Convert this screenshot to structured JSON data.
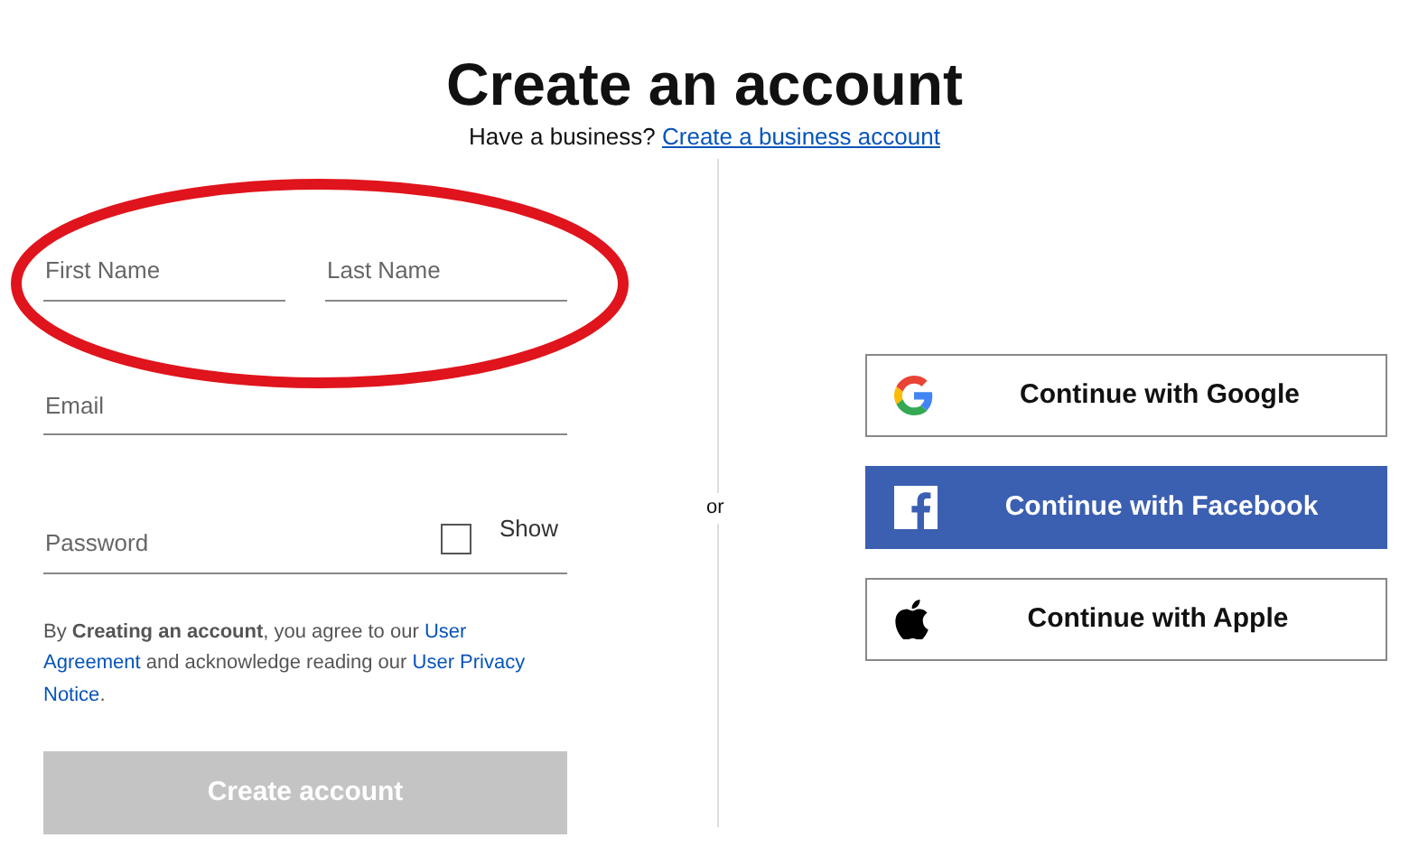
{
  "title": "Create an account",
  "subtitle": {
    "text": "Have a business?",
    "link": "Create a business account"
  },
  "form": {
    "fields": [
      {
        "kind": "first_name",
        "placeholder": "First Name"
      },
      {
        "kind": "last_name",
        "placeholder": "Last Name"
      },
      {
        "kind": "email",
        "placeholder": "Email"
      },
      {
        "kind": "password",
        "placeholder": "Password"
      }
    ],
    "show_password": {
      "label": "Show",
      "checked": false
    },
    "terms_lines": [
      [
        {
          "kind": "text",
          "text": "By **Creating an account**, you agree to our "
        },
        {
          "kind": "link",
          "text": "User"
        }
      ],
      [
        {
          "kind": "link",
          "text": "Agreement"
        },
        {
          "kind": "text",
          "text": " and acknowledge reading our "
        },
        {
          "kind": "link",
          "text": "User Privacy"
        }
      ],
      [
        {
          "kind": "link",
          "text": "Notice"
        },
        {
          "kind": "text",
          "text": "."
        }
      ]
    ],
    "submit": {
      "label": "Create account",
      "disabled": true
    }
  },
  "separator": "or",
  "social_buttons": [
    {
      "kind": "google",
      "label": "Continue with Google"
    },
    {
      "kind": "facebook",
      "label": "Continue with Facebook"
    },
    {
      "kind": "apple",
      "label": "Continue with Apple"
    }
  ],
  "highlight": {
    "kind": "ellipse"
  }
}
